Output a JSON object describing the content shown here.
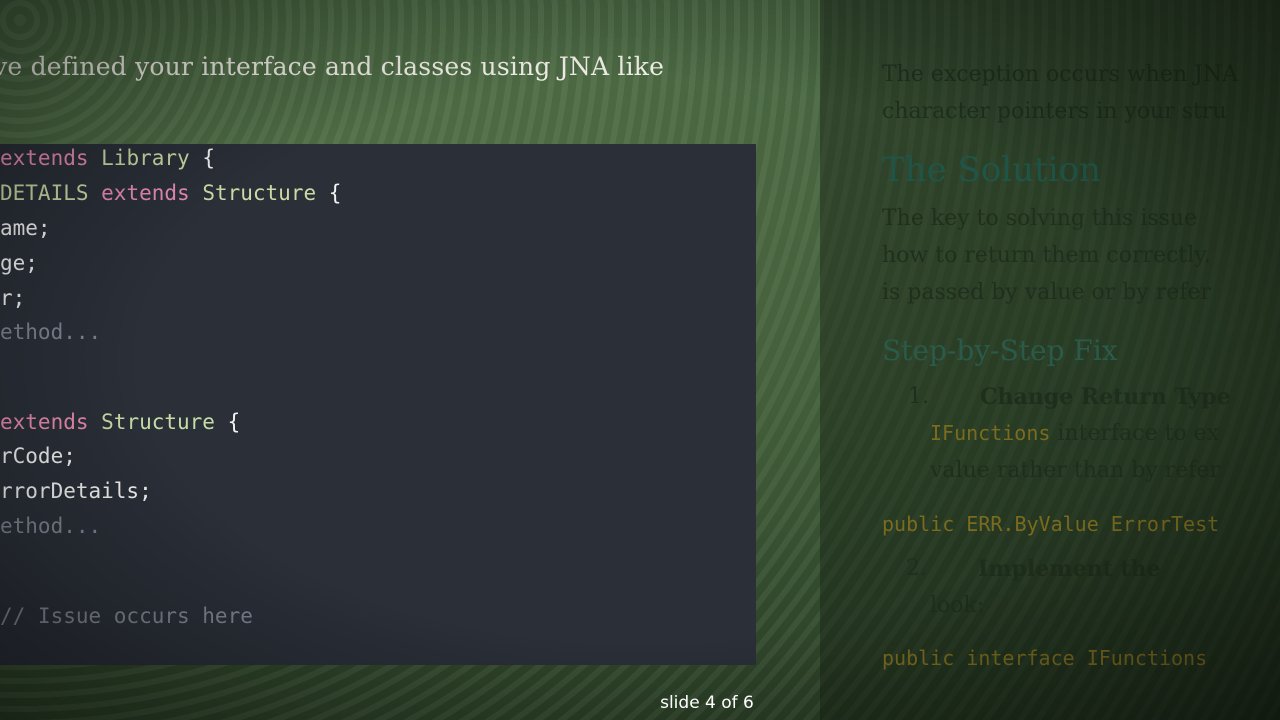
{
  "slide": {
    "headline": "ave defined your interface and classes using JNA like",
    "counter": "slide 4 of 6"
  },
  "code": {
    "line1": {
      "a": "extends",
      "b": " Library",
      "c": " {"
    },
    "line2": {
      "a": "DETAILS",
      "b": " extends",
      "c": " Structure",
      "d": " {"
    },
    "line3": "ame;",
    "line4": "ge;",
    "line5": "r;",
    "line6": "ethod...",
    "line7": {
      "a": "extends",
      "b": " Structure",
      "c": " {"
    },
    "line8": "rCode;",
    "line9": "rrorDetails;",
    "line10": "ethod...",
    "line11": "// Issue occurs here"
  },
  "right": {
    "p1_l1": "The exception occurs when JNA",
    "p1_l2": "character pointers in your stru",
    "h2": "The Solution",
    "p2_l1": "The key to solving this issue",
    "p2_l2": "how to return them correctly.",
    "p2_l3": "is passed by value or by refer",
    "h3": "Step-by-Step Fix",
    "li1_num": "1.",
    "li1_bold": "Change Return Type",
    "li1_code": "IFunctions",
    "li1_rest": " interface to ex",
    "li1_l3": "value rather than by refer",
    "code1": "public ERR.ByValue ErrorTest",
    "li2_num": "2.",
    "li2_bold": "Implement the",
    "li2_l2": "look:",
    "code2": "public interface IFunctions"
  }
}
